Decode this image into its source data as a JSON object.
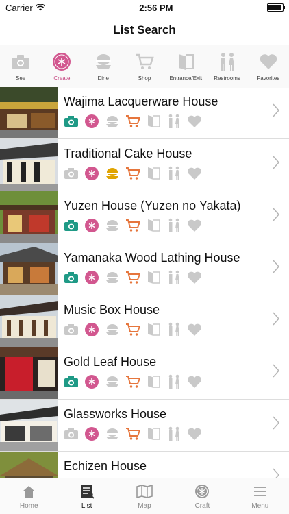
{
  "status_bar": {
    "carrier": "Carrier",
    "time": "2:56 PM"
  },
  "header": {
    "title": "List Search"
  },
  "filters": [
    {
      "label": "See",
      "icon": "camera-icon",
      "active": false
    },
    {
      "label": "Create",
      "icon": "craft-badge-icon",
      "active": true
    },
    {
      "label": "Dine",
      "icon": "dish-icon",
      "active": false
    },
    {
      "label": "Shop",
      "icon": "cart-icon",
      "active": false
    },
    {
      "label": "Entrance/Exit",
      "icon": "door-icon",
      "active": false
    },
    {
      "label": "Restrooms",
      "icon": "restroom-icon",
      "active": false
    },
    {
      "label": "Favorites",
      "icon": "heart-icon",
      "active": false
    }
  ],
  "items": [
    {
      "name": "Wajima Lacquerware House",
      "amenities": {
        "see": true,
        "create": true,
        "dine": false,
        "shop": true,
        "entrance": false,
        "restroom": false,
        "favorite": false
      }
    },
    {
      "name": "Traditional Cake House",
      "amenities": {
        "see": false,
        "create": true,
        "dine": true,
        "shop": true,
        "entrance": false,
        "restroom": false,
        "favorite": false
      }
    },
    {
      "name": "Yuzen House (Yuzen no Yakata)",
      "amenities": {
        "see": true,
        "create": true,
        "dine": false,
        "shop": true,
        "entrance": false,
        "restroom": false,
        "favorite": false
      }
    },
    {
      "name": "Yamanaka Wood Lathing House",
      "amenities": {
        "see": true,
        "create": true,
        "dine": false,
        "shop": true,
        "entrance": false,
        "restroom": false,
        "favorite": false
      }
    },
    {
      "name": "Music Box House",
      "amenities": {
        "see": false,
        "create": true,
        "dine": false,
        "shop": true,
        "entrance": false,
        "restroom": false,
        "favorite": false
      }
    },
    {
      "name": "Gold Leaf House",
      "amenities": {
        "see": true,
        "create": true,
        "dine": false,
        "shop": true,
        "entrance": false,
        "restroom": false,
        "favorite": false
      }
    },
    {
      "name": "Glassworks House",
      "amenities": {
        "see": false,
        "create": true,
        "dine": false,
        "shop": true,
        "entrance": false,
        "restroom": false,
        "favorite": false
      }
    },
    {
      "name": "Echizen House",
      "amenities": {
        "see": false,
        "create": true,
        "dine": false,
        "shop": true,
        "entrance": false,
        "restroom": false,
        "favorite": false
      }
    }
  ],
  "tabs": [
    {
      "label": "Home",
      "icon": "home-icon",
      "active": false
    },
    {
      "label": "List",
      "icon": "list-icon",
      "active": true
    },
    {
      "label": "Map",
      "icon": "map-icon",
      "active": false
    },
    {
      "label": "Craft",
      "icon": "craft-icon",
      "active": false
    },
    {
      "label": "Menu",
      "icon": "menu-icon",
      "active": false
    }
  ],
  "colors": {
    "see_active": "#1f9a86",
    "create_active": "#d2578f",
    "dine_active": "#e0a400",
    "shop_active": "#e6763d",
    "inactive": "#c9c9c9"
  }
}
